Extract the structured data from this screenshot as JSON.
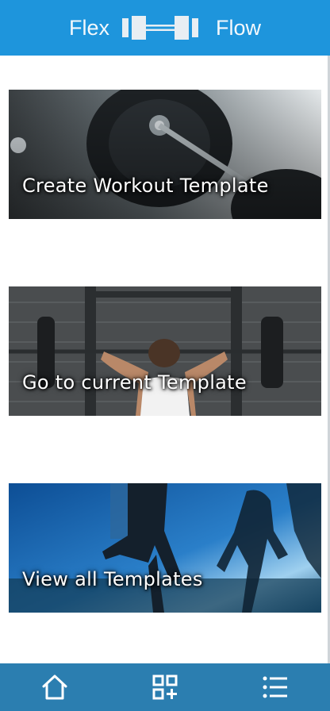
{
  "header": {
    "brand_left": "Flex",
    "brand_right": "Flow",
    "logo_icon": "dumbbell-icon",
    "background_color": "#1e95dc"
  },
  "cards": [
    {
      "label": "Create Workout Template",
      "image": "barbell-plate-photo"
    },
    {
      "label": "Go to current Template",
      "image": "woman-lifting-barbell-photo"
    },
    {
      "label": "View all Templates",
      "image": "runners-silhouette-photo"
    }
  ],
  "bottom_nav": {
    "background_color": "#2b7eb0",
    "items": [
      {
        "icon": "home-icon"
      },
      {
        "icon": "grid-add-icon"
      },
      {
        "icon": "list-icon"
      }
    ]
  }
}
